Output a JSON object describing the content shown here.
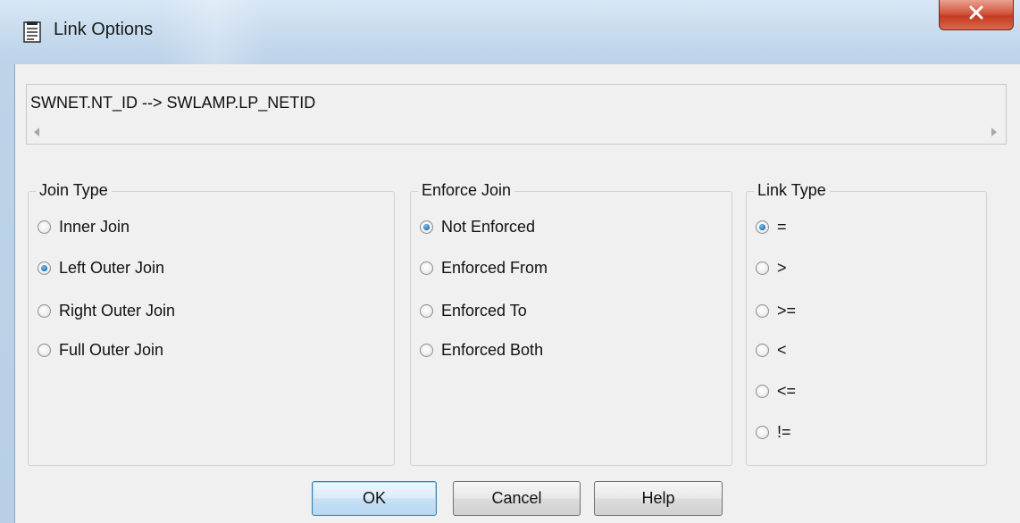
{
  "window": {
    "title": "Link Options",
    "close_glyph": "X",
    "icon": "document-page-icon"
  },
  "link_path": "SWNET.NT_ID --> SWLAMP.LP_NETID",
  "join_type": {
    "label": "Join Type",
    "options": [
      "Inner Join",
      "Left Outer Join",
      "Right Outer Join",
      "Full Outer Join"
    ],
    "selected": "Left Outer Join"
  },
  "enforce_join": {
    "label": "Enforce Join",
    "options": [
      "Not Enforced",
      "Enforced From",
      "Enforced To",
      "Enforced Both"
    ],
    "selected": "Not Enforced"
  },
  "link_type": {
    "label": "Link Type",
    "options": [
      "=",
      ">",
      ">=",
      "<",
      "<=",
      "!="
    ],
    "selected": "="
  },
  "buttons": {
    "ok": "OK",
    "cancel": "Cancel",
    "help": "Help"
  },
  "colors": {
    "titlebar": "#c7dbee",
    "close_button": "#c43b22",
    "dialog_background": "#f0f0f0",
    "radio_selected": "#1f6fb5"
  }
}
